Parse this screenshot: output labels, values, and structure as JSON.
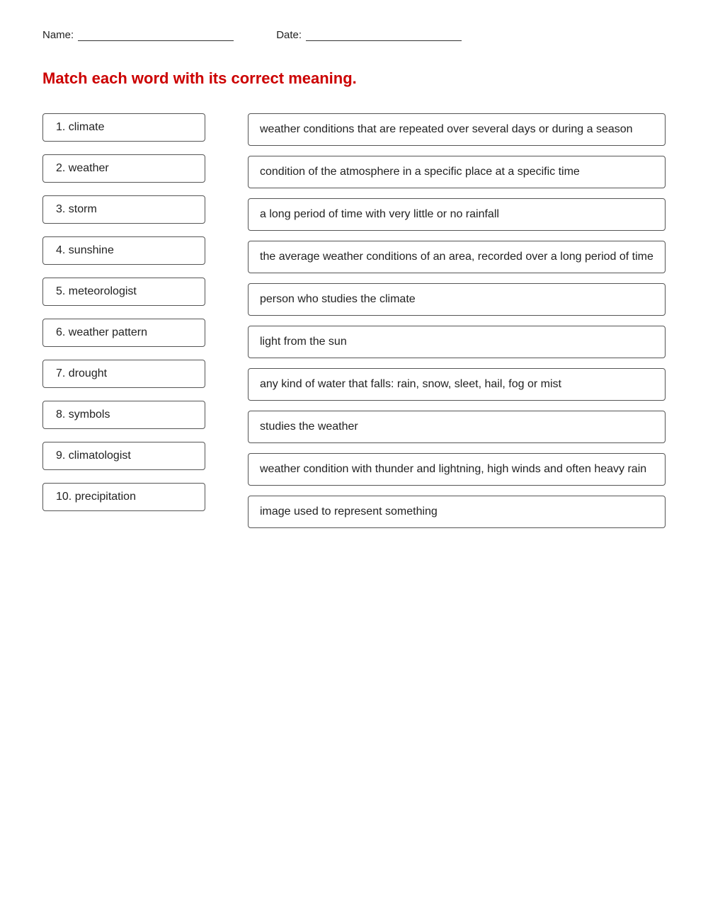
{
  "header": {
    "name_label": "Name:",
    "date_label": "Date:"
  },
  "title": "Match each word with its correct meaning.",
  "terms": [
    {
      "id": "term-1",
      "label": "1.  climate"
    },
    {
      "id": "term-2",
      "label": "2. weather"
    },
    {
      "id": "term-3",
      "label": "3. storm"
    },
    {
      "id": "term-4",
      "label": "4. sunshine"
    },
    {
      "id": "term-5",
      "label": "5. meteorologist"
    },
    {
      "id": "term-6",
      "label": "6. weather pattern"
    },
    {
      "id": "term-7",
      "label": "7. drought"
    },
    {
      "id": "term-8",
      "label": "8. symbols"
    },
    {
      "id": "term-9",
      "label": "9. climatologist"
    },
    {
      "id": "term-10",
      "label": "10. precipitation"
    }
  ],
  "definitions": [
    {
      "id": "def-1",
      "text": "weather conditions that are repeated over several days or during a  season"
    },
    {
      "id": "def-2",
      "text": "condition of the atmosphere in a specific place at a specific time"
    },
    {
      "id": "def-3",
      "text": "a long period of time with very little or no rainfall"
    },
    {
      "id": "def-4",
      "text": "the average weather conditions of an area, recorded over a long period of time"
    },
    {
      "id": "def-5",
      "text": "person who studies the climate"
    },
    {
      "id": "def-6",
      "text": "light from the sun"
    },
    {
      "id": "def-7",
      "text": "any kind of water that falls: rain, snow, sleet, hail, fog or mist"
    },
    {
      "id": "def-8",
      "text": "studies the weather"
    },
    {
      "id": "def-9",
      "text": "weather condition with thunder and lightning, high winds and often heavy rain"
    },
    {
      "id": "def-10",
      "text": "image used to represent something"
    }
  ]
}
